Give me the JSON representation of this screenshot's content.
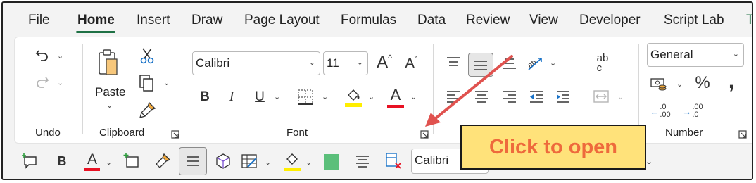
{
  "tabs": [
    "File",
    "Home",
    "Insert",
    "Draw",
    "Page Layout",
    "Formulas",
    "Data",
    "Review",
    "View",
    "Developer",
    "Script Lab",
    "T"
  ],
  "groups": {
    "undo": "Undo",
    "clipboard": "Clipboard",
    "font": "Font",
    "number": "Number"
  },
  "clipboard": {
    "paste_label": "Paste"
  },
  "font": {
    "name": "Calibri",
    "size": "11",
    "bold": "B",
    "italic": "I",
    "underline": "U",
    "font_color_glyph": "A",
    "grow_glyph": "A",
    "shrink_glyph": "A"
  },
  "alignment": {
    "wrap_glyph": "ab\nc"
  },
  "number": {
    "format": "General",
    "percent": "%",
    "comma": ",",
    "increase_decimal": ".0\n.00",
    "decrease_decimal": ".00\n.0"
  },
  "qat": {
    "bold": "B",
    "font_color_glyph": "A",
    "font_name": "Calibri"
  },
  "annotation": {
    "text": "Click to open"
  },
  "colors": {
    "accent_green": "#1f7145",
    "font_color_red": "#e81123",
    "highlight_yellow": "#ffee00",
    "callout_fill": "#ffe27a",
    "callout_text": "#ee6a3c",
    "arrow": "#e0524f",
    "fill_green": "#5bbf7a"
  }
}
